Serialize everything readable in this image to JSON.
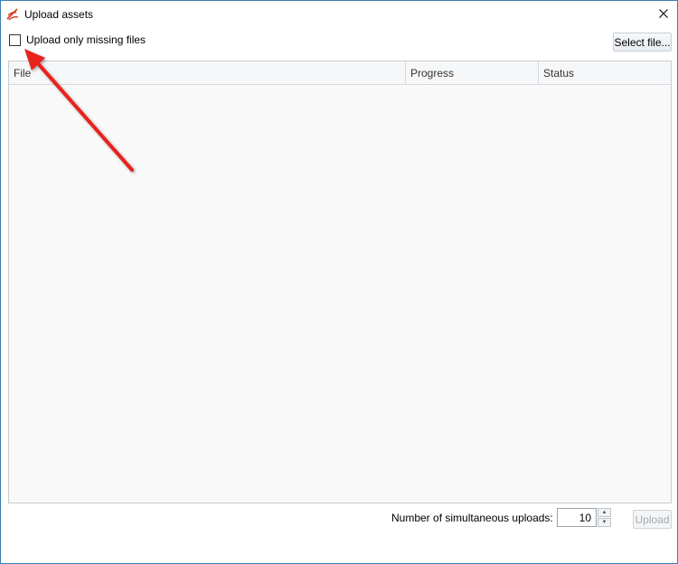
{
  "window": {
    "title": "Upload assets",
    "app_icon": "pen-logo-icon",
    "close_icon": "close-icon"
  },
  "options": {
    "only_missing_label": "Upload only missing files",
    "only_missing_checked": false,
    "select_file_label": "Select file..."
  },
  "grid": {
    "columns": [
      "File",
      "Progress",
      "Status"
    ],
    "rows": []
  },
  "footer": {
    "simultaneous_label": "Number of simultaneous uploads:",
    "simultaneous_value": "10",
    "upload_label": "Upload",
    "upload_enabled": false
  },
  "annotation": {
    "color": "#e8231f",
    "target": "only-missing-checkbox"
  }
}
